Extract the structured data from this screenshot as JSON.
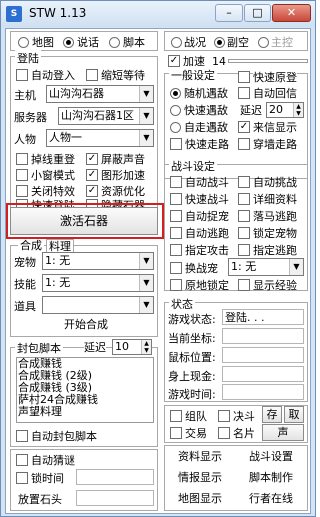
{
  "window": {
    "title": "STW 1.13",
    "icon_text": "S",
    "min": "–",
    "max": "□",
    "close": "✕"
  },
  "top_tabs": {
    "map": "地图",
    "talk": "说话",
    "script": "脚本"
  },
  "login": {
    "legend": "登陆",
    "auto_login": "自动登入",
    "shorten_wait": "缩短等待",
    "host_label": "主机",
    "host_value": "山沟沟石器",
    "server_label": "服务器",
    "server_value": "山沟沟石器1区",
    "char_label": "人物",
    "char_value": "人物一",
    "reconnect": "掉线重登",
    "block_sound": "屏蔽声音",
    "small_window": "小窗模式",
    "graphic_accel": "图形加速",
    "disable_fx": "关闭特效",
    "resource_opt": "资源优化",
    "fast_login": "快速登陆",
    "hide_stone": "隐藏石器"
  },
  "activate_button": "激活石器",
  "synthesis": {
    "tab_synth": "合成",
    "tab_cook": "料理",
    "pet_label": "宠物",
    "pet_value": "1: 无",
    "skill_label": "技能",
    "skill_value": "1: 无",
    "item_label": "道具",
    "start": "开始合成"
  },
  "packet": {
    "legend": "封包脚本",
    "delay_label": "延迟",
    "delay_value": "10",
    "scripts": [
      "合成赚钱",
      "合成赚钱 (2级)",
      "合成赚钱 (3级)",
      "萨村24合成赚钱",
      "声望料理"
    ],
    "auto_packet": "自动封包脚本"
  },
  "bottom_left": {
    "auto_riddle": "自动猜谜",
    "lock_time": "锁时间",
    "zoom_label": "放置石头"
  },
  "right_tabs": {
    "battle": "战况",
    "dialog": "副空",
    "master": "主控"
  },
  "accel": {
    "label": "加速",
    "value": "14"
  },
  "general": {
    "legend": "一般设定",
    "fast_encounter": "快速原登",
    "random_encounter": "随机遇敌",
    "auto_reply": "自动回信",
    "fast_encounter2": "快速遇敌",
    "delay_label": "延迟",
    "delay_value": "20",
    "free_encounter": "自走遇敌",
    "mail_show": "来信显示",
    "fast_walk": "快速走路",
    "through_wall": "穿墙走路"
  },
  "battle": {
    "legend": "战斗设定",
    "auto_battle": "自动战斗",
    "auto_challenge": "自动挑战",
    "fast_battle": "快速战斗",
    "detail_info": "详细资料",
    "auto_catch": "自动捉宠",
    "fall_escape": "落马逃跑",
    "auto_escape": "自动逃跑",
    "lock_pet": "锁定宠物",
    "target_attack": "指定攻击",
    "target_escape": "指定逃跑",
    "swap_pet": "换战宠",
    "swap_value": "1: 无",
    "stay_lock": "原地锁定",
    "show_exp": "显示经验"
  },
  "status": {
    "legend": "状态",
    "game_state_label": "游戏状态:",
    "game_state_value": "登陆. . .",
    "coords_label": "当前坐标:",
    "mouse_label": "鼠标位置:",
    "money_label": "身上现金:",
    "time_label": "游戏时间:"
  },
  "social": {
    "team": "组队",
    "duel": "决斗",
    "save": "存",
    "take": "取",
    "trade": "交易",
    "card": "名片",
    "voice": "声"
  },
  "bottom_buttons": {
    "data_show": "资料显示",
    "battle_setting": "战斗设置",
    "info_show": "情报显示",
    "script_make": "脚本制作",
    "map_show": "地图显示",
    "walker_online": "行者在线"
  },
  "colors": {
    "title_bg": "#d4e4f4",
    "highlight": "#d02020"
  }
}
